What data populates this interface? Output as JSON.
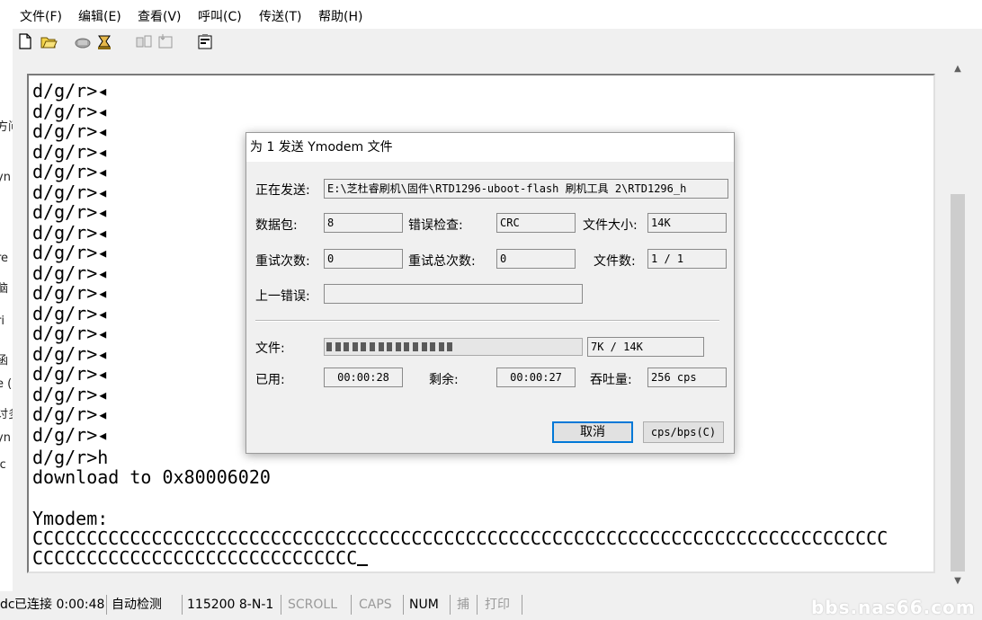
{
  "menu": {
    "items": [
      "文件(F)",
      "编辑(E)",
      "查看(V)",
      "呼叫(C)",
      "传送(T)",
      "帮助(H)"
    ]
  },
  "toolbar": {
    "icons": [
      "new-file-icon",
      "open-folder-icon",
      "disconnect-phone-icon",
      "connect-phone-icon",
      "send-icon",
      "receive-icon",
      "properties-icon"
    ]
  },
  "left_window": {
    "fragments": [
      "方问",
      "yn",
      "re",
      "脑",
      "ri",
      "函",
      "e (",
      "讨多",
      "yn",
      "ic"
    ]
  },
  "terminal": {
    "prompt_lines": [
      "d/g/r>◂",
      "d/g/r>◂",
      "d/g/r>◂",
      "d/g/r>◂",
      "d/g/r>◂",
      "d/g/r>◂",
      "d/g/r>◂",
      "d/g/r>◂",
      "d/g/r>◂",
      "d/g/r>◂",
      "d/g/r>◂",
      "d/g/r>◂",
      "d/g/r>◂",
      "d/g/r>◂",
      "d/g/r>◂",
      "d/g/r>◂",
      "d/g/r>◂",
      "d/g/r>◂"
    ],
    "line_h": "d/g/r>h",
    "download": "download to 0x80006020",
    "ymodem": "Ymodem:",
    "c_line1": "CCCCCCCCCCCCCCCCCCCCCCCCCCCCCCCCCCCCCCCCCCCCCCCCCCCCCCCCCCCCCCCCCCCCCCCCCCCCCCC",
    "c_line2": "CCCCCCCCCCCCCCCCCCCCCCCCCCCCCC"
  },
  "dialog": {
    "title": "为 1 发送 Ymodem 文件",
    "sending_label": "正在发送:",
    "sending_value": "E:\\芝杜睿刷机\\固件\\RTD1296-uboot-flash 刷机工具 2\\RTD1296_h",
    "packet_label": "数据包:",
    "packet_value": "8",
    "error_check_label": "错误检查:",
    "error_check_value": "CRC",
    "file_size_label": "文件大小:",
    "file_size_value": "14K",
    "retries_label": "重试次数:",
    "retries_value": "0",
    "total_retries_label": "重试总次数:",
    "total_retries_value": "0",
    "file_count_label": "文件数:",
    "file_count_value": "1 / 1",
    "last_error_label": "上一错误:",
    "last_error_value": "",
    "file_label": "文件:",
    "progress_fraction": 0.5,
    "progress_text": "7K / 14K",
    "elapsed_label": "已用:",
    "elapsed_value": "00:00:28",
    "remaining_label": "剩余:",
    "remaining_value": "00:00:27",
    "throughput_label": "吞吐量:",
    "throughput_value": "256 cps",
    "cancel_label": "取消",
    "cps_bps_label": "cps/bps(C)"
  },
  "status": {
    "left_frag": "dc",
    "connected": "已连接 0:00:48",
    "detect": "自动检测",
    "port": "115200 8-N-1",
    "scroll": "SCROLL",
    "caps": "CAPS",
    "num": "NUM",
    "capture": "捕",
    "print": "打印"
  },
  "watermark": "bbs.nas66.com"
}
